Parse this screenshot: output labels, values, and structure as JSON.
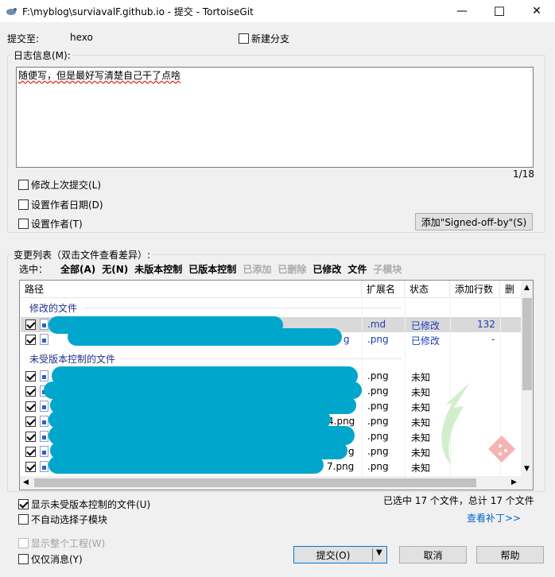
{
  "window": {
    "title": "F:\\myblog\\surviavalF.github.io - 提交 - TortoiseGit",
    "minimize": "—",
    "maximize": "☐",
    "close": "✕"
  },
  "commit_to": {
    "label": "提交至:",
    "branch": "hexo",
    "new_branch_label": "新建分支"
  },
  "log": {
    "legend": "日志信息(M):",
    "message": "随便写，但是最好写清楚自己干了点啥",
    "counter": "1/18"
  },
  "options": {
    "amend_label": "修改上次提交(L)",
    "set_date_label": "设置作者日期(D)",
    "set_author_label": "设置作者(T)",
    "signed_off_button": "添加\"Signed-off-by\"(S)"
  },
  "changes": {
    "legend": "变更列表（双击文件查看差异）:",
    "select_label": "选中：",
    "filters": [
      {
        "label": "全部(A)",
        "enabled": true
      },
      {
        "label": "无(N)",
        "enabled": true
      },
      {
        "label": "未版本控制",
        "enabled": true
      },
      {
        "label": "已版本控制",
        "enabled": true
      },
      {
        "label": "已添加",
        "enabled": false
      },
      {
        "label": "已删除",
        "enabled": false
      },
      {
        "label": "已修改",
        "enabled": true
      },
      {
        "label": "文件",
        "enabled": true
      },
      {
        "label": "子模块",
        "enabled": false
      }
    ],
    "columns": [
      "路径",
      "扩展名",
      "状态",
      "添加行数",
      "删"
    ],
    "group_modified": "修改的文件",
    "group_unversioned": "未受版本控制的文件",
    "modified_rows": [
      {
        "ext": ".md",
        "status": "已修改",
        "added": "132",
        "path_tail": ""
      },
      {
        "ext": ".png",
        "status": "已修改",
        "added": "-",
        "path_tail": "g"
      }
    ],
    "unversioned_rows": [
      {
        "ext": ".png",
        "status": "未知",
        "path_tail": ""
      },
      {
        "ext": ".png",
        "status": "未知",
        "path_tail": ""
      },
      {
        "ext": ".png",
        "status": "未知",
        "path_tail": ""
      },
      {
        "ext": ".png",
        "status": "未知",
        "path_tail": "4.png"
      },
      {
        "ext": ".png",
        "status": "未知",
        "path_tail": ""
      },
      {
        "ext": ".png",
        "status": "未知",
        "path_tail": "g"
      },
      {
        "ext": ".png",
        "status": "未知",
        "path_tail": "7.png"
      }
    ]
  },
  "bottom": {
    "show_unversioned_label": "显示未受版本控制的文件(U)",
    "no_auto_submodule_label": "不自动选择子模块",
    "selection_summary": "已选中 17 个文件，总计 17 个文件",
    "view_patch_link": "查看补丁>>",
    "show_whole_project_label": "显示整个工程(W)",
    "message_only_label": "仅仅消息(Y)",
    "commit_button": "提交(O)",
    "cancel_button": "取消",
    "help_button": "帮助"
  },
  "colors": {
    "redaction": "#00a6cc",
    "link": "#0066cc",
    "status_text": "#1e3cb4"
  }
}
